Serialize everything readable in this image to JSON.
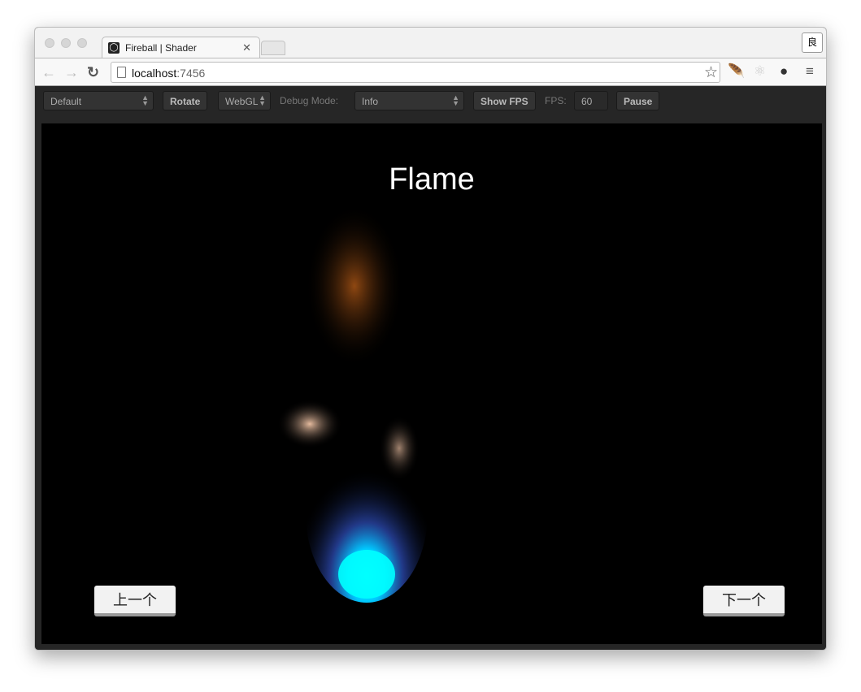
{
  "browser": {
    "tab_title": "Fireball | Shader",
    "url_host": "localhost",
    "url_port": ":7456",
    "profile_label": "良"
  },
  "toolbar": {
    "scene_select": "Default",
    "rotate": "Rotate",
    "renderer_select": "WebGL",
    "debug_label": "Debug Mode:",
    "debug_select": "Info",
    "show_fps": "Show FPS",
    "fps_label": "FPS:",
    "fps_value": "60",
    "pause": "Pause"
  },
  "canvas": {
    "title": "Flame",
    "prev": "上一个",
    "next": "下一个"
  },
  "colors": {
    "flame_base": "#00f0ff",
    "flame_mid": "#ffffff",
    "flame_top": "#ff7a10"
  }
}
